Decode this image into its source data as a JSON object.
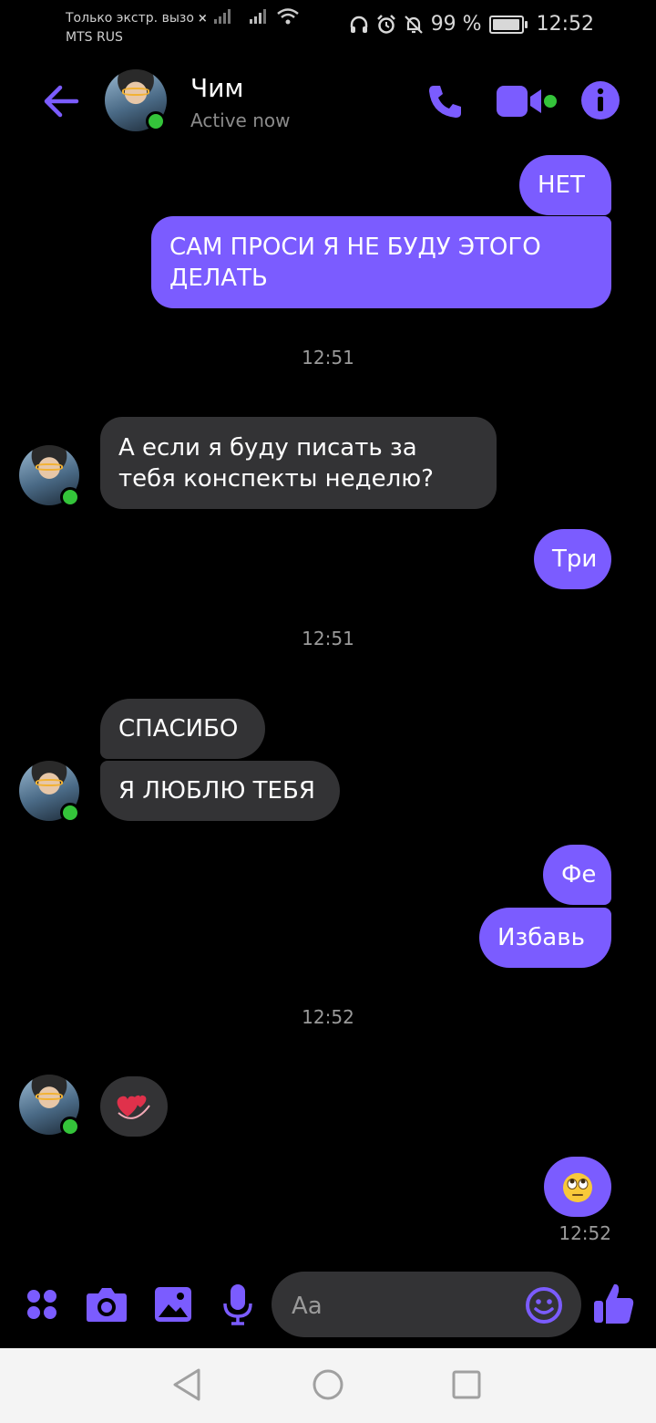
{
  "status_bar": {
    "carrier_line1": "Только экстр. вызо",
    "carrier_line2": "MTS RUS",
    "battery_text": "99 %",
    "battery_level": 0.99,
    "time": "12:52"
  },
  "header": {
    "contact_name": "Чим",
    "presence": "Active now"
  },
  "messages": [
    {
      "side": "me",
      "text": "НЕТ"
    },
    {
      "side": "me",
      "text": "САМ ПРОСИ Я НЕ БУДУ ЭТОГО ДЕЛАТЬ"
    },
    {
      "side": "time",
      "text": "12:51"
    },
    {
      "side": "them",
      "text": "А если я буду писать за тебя конспекты неделю?"
    },
    {
      "side": "me",
      "text": "Три"
    },
    {
      "side": "time",
      "text": "12:51"
    },
    {
      "side": "them",
      "text": "СПАСИБО"
    },
    {
      "side": "them",
      "text": "Я ЛЮБЛЮ ТЕБЯ"
    },
    {
      "side": "me",
      "text": "Фе"
    },
    {
      "side": "me",
      "text": "Избавь"
    },
    {
      "side": "time",
      "text": "12:52"
    },
    {
      "side": "them",
      "emoji": "revolving-hearts"
    },
    {
      "side": "me",
      "emoji": "eye-roll-face"
    },
    {
      "side": "sent_time",
      "text": "12:52"
    }
  ],
  "composer": {
    "placeholder": "Aa"
  },
  "colors": {
    "accent": "#7b5cff",
    "them_bubble": "#333335",
    "online": "#34c43a",
    "background": "#000000"
  }
}
